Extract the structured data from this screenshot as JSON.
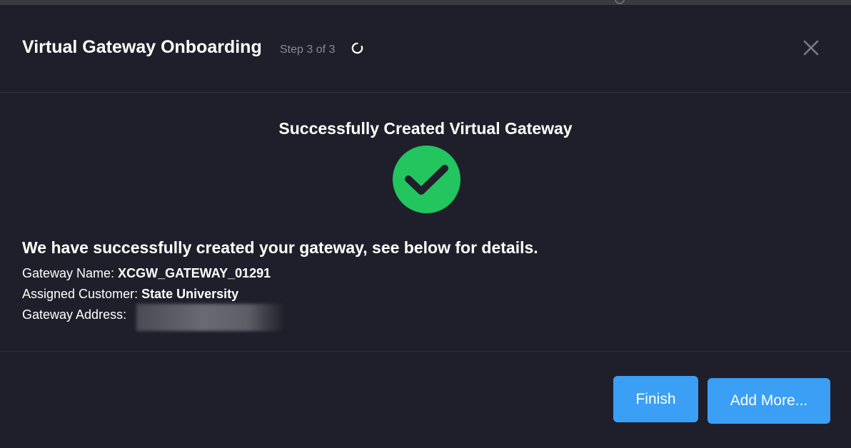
{
  "modal": {
    "title": "Virtual Gateway Onboarding",
    "step_label": "Step 3 of 3"
  },
  "result": {
    "heading": "Successfully Created Virtual Gateway",
    "message": "We have successfully created your gateway, see below for details.",
    "details": [
      {
        "label": "Gateway Name:",
        "value": "XCGW_GATEWAY_01291"
      },
      {
        "label": "Assigned Customer:",
        "value": "State University"
      },
      {
        "label": "Gateway Address:",
        "value": ""
      }
    ]
  },
  "footer": {
    "finish_label": "Finish",
    "add_more_label": "Add More..."
  },
  "icons": {
    "close": "close-icon",
    "spinner": "loading-spinner-icon",
    "success": "check-circle-icon"
  },
  "colors": {
    "background": "#1f1f2b",
    "accent": "#3a9ff5",
    "success": "#22c55e"
  }
}
